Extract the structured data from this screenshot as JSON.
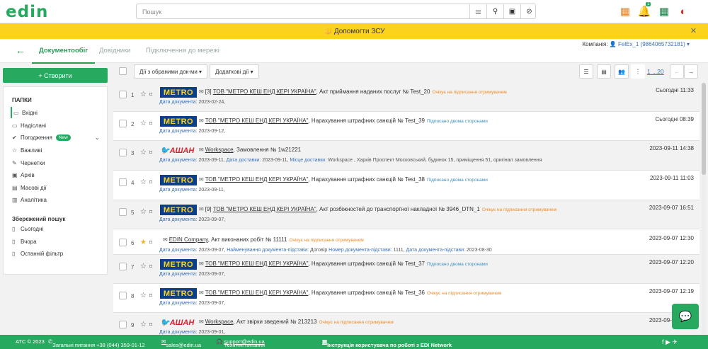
{
  "header": {
    "logo": "edin",
    "search_placeholder": "Пошук",
    "notification_count": "1"
  },
  "banner": {
    "text": "Допомогти ЗСУ",
    "emblem": "🔱"
  },
  "nav": {
    "tabs": [
      "Документообіг",
      "Довідники",
      "Підключення до мережі"
    ],
    "company_label": "Компанія:",
    "company_value": "FelEx_1 (9864065732181)"
  },
  "sidebar": {
    "create_label": "+ Створити",
    "folders_title": "ПАПКИ",
    "folders": [
      "Вхідні",
      "Надіслані",
      "Погодження",
      "Важливі",
      "Чернетки",
      "Архів",
      "Масові дії",
      "Аналітика"
    ],
    "new_badge": "New",
    "saved_title": "Збережений пошук",
    "saved": [
      "Сьогодні",
      "Вчора",
      "Останній фільтр"
    ]
  },
  "toolbar": {
    "actions_selected": "Дії з обраними док-ми",
    "extra_actions": "Додаткові дії",
    "pagination": "1 ...20"
  },
  "rows": [
    {
      "n": "1",
      "logo": "METRO",
      "prefix": "[3]",
      "company": "ТОВ \"МЕТРО КЕШ ЕНД КЕРІ УКРАЇНА\"",
      "doc": ", Акт приймання наданих послуг № Test_20",
      "status": "Очікує на підписання отримувачем",
      "status_color": "o",
      "line2": [
        [
          "Дата документа:",
          "2023-02-24,"
        ]
      ],
      "date": "Сьогодні 11:33",
      "starred": false,
      "grey": true
    },
    {
      "n": "2",
      "logo": "METRO",
      "prefix": "",
      "company": "ТОВ \"МЕТРО КЕШ ЕНД КЕРІ УКРАЇНА\"",
      "doc": ", Нарахування штрафних санкцій № Test_39",
      "status": "Підписано двома сторонами",
      "status_color": "b",
      "line2": [
        [
          "Дата документа:",
          "2023-09-12,"
        ]
      ],
      "date": "Сьогодні 08:39",
      "starred": false,
      "grey": false
    },
    {
      "n": "3",
      "logo": "АШАН",
      "prefix": "",
      "company": "Workspace",
      "doc": ", Замовлення № 1w21221",
      "status": "",
      "status_color": "",
      "line2": [
        [
          "Дата документа:",
          "2023-09-11,"
        ],
        [
          "Дата доставки:",
          "2023-09-11,"
        ],
        [
          "Місце доставки:",
          "Workspace , Харків Проспект Московський, будинок 15, приміщення 51, оригінал замовлення"
        ]
      ],
      "date": "2023-09-11 14:38",
      "starred": false,
      "grey": true
    },
    {
      "n": "4",
      "logo": "METRO",
      "prefix": "",
      "company": "ТОВ \"МЕТРО КЕШ ЕНД КЕРІ УКРАЇНА\"",
      "doc": ", Нарахування штрафних санкцій № Test_38",
      "status": "Підписано двома сторонами",
      "status_color": "b",
      "line2": [
        [
          "Дата документа:",
          "2023-09-11,"
        ]
      ],
      "date": "2023-09-11 11:03",
      "starred": false,
      "grey": false
    },
    {
      "n": "5",
      "logo": "METRO",
      "prefix": "[9]",
      "company": "ТОВ \"МЕТРО КЕШ ЕНД КЕРІ УКРАЇНА\"",
      "doc": ", Акт розбіжностей до транспортної накладної № 3946_DTN_1",
      "status": "Очікує на підписання отримувачем",
      "status_color": "o",
      "line2": [
        [
          "Дата документа:",
          "2023-09-07,"
        ]
      ],
      "date": "2023-09-07 16:51",
      "starred": false,
      "grey": true
    },
    {
      "n": "6",
      "logo": "",
      "prefix": "",
      "company": "EDIN Company",
      "doc": ", Акт виконаних робіт № 11111",
      "status": "Очікує на підписання отримувачем",
      "status_color": "o",
      "line2": [
        [
          "Дата документа:",
          "2023-09-07,"
        ],
        [
          "Найменування документа-підстави:",
          "Договір"
        ],
        [
          "Номер документа-підстави:",
          "1111,"
        ],
        [
          "Дата документа-підстави:",
          "2023-08-30"
        ]
      ],
      "date": "2023-09-07 12:30",
      "starred": true,
      "grey": false
    },
    {
      "n": "7",
      "logo": "METRO",
      "prefix": "",
      "company": "ТОВ \"МЕТРО КЕШ ЕНД КЕРІ УКРАЇНА\"",
      "doc": ", Нарахування штрафних санкцій № Test_37",
      "status": "Підписано двома сторонами",
      "status_color": "b",
      "line2": [
        [
          "Дата документа:",
          "2023-09-07,"
        ]
      ],
      "date": "2023-09-07 12:20",
      "starred": false,
      "grey": true
    },
    {
      "n": "8",
      "logo": "METRO",
      "prefix": "",
      "company": "ТОВ \"МЕТРО КЕШ ЕНД КЕРІ УКРАЇНА\"",
      "doc": ", Нарахування штрафних санкцій № Test_36",
      "status": "Очікує на підписання отримувачем",
      "status_color": "o",
      "line2": [
        [
          "Дата документа:",
          "2023-09-07,"
        ]
      ],
      "date": "2023-09-07 12:19",
      "starred": false,
      "grey": false
    },
    {
      "n": "9",
      "logo": "АШАН",
      "prefix": "",
      "company": "Workspace",
      "doc": ", Акт звірки зведений № 213213",
      "status": "Очікує на підписання отримувачем",
      "status_color": "o",
      "line2": [
        [
          "Дата документа:",
          "2023-09-01,"
        ]
      ],
      "date": "2023-09-07 12:00",
      "starred": false,
      "grey": true
    }
  ],
  "footer": {
    "copyright": "АТС © 2023",
    "general_phone": "Загальні питання +38 (044) 359-01-12",
    "sales_email": "sales@edin.ua",
    "tech_label": "Технічні питання",
    "tech_email": "support@edin.ua",
    "manual": "Інструкція користувача по роботі з EDI Network"
  },
  "colors": {
    "brand": "#27a960",
    "banner": "#fbd31c",
    "link": "#3c6fb5",
    "pending": "#f08a24",
    "signed": "#3c8fbf"
  }
}
